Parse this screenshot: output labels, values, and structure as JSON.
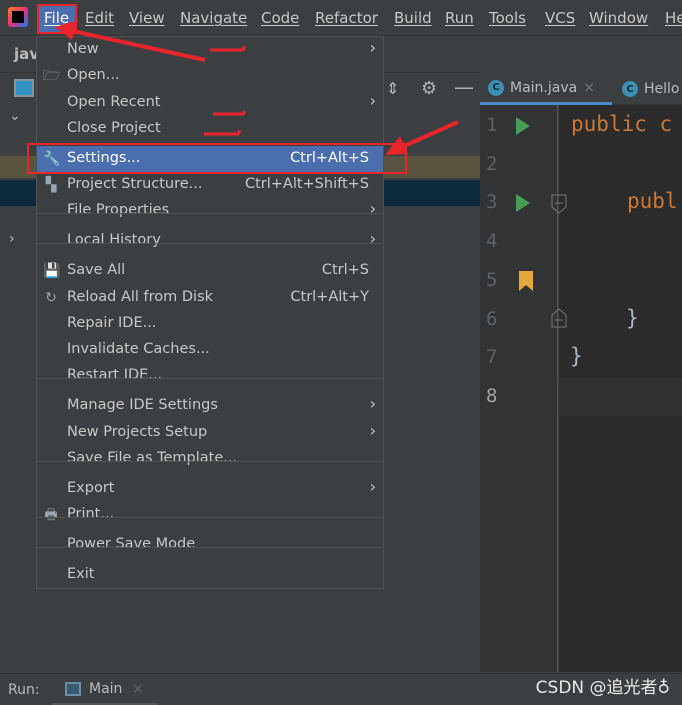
{
  "menubar": [
    "File",
    "Edit",
    "View",
    "Navigate",
    "Code",
    "Refactor",
    "Build",
    "Run",
    "Tools",
    "VCS",
    "Window",
    "He"
  ],
  "project_label": "jav",
  "editor": {
    "tabs": [
      "Main.java",
      "Hello"
    ],
    "line_numbers": [
      "1",
      "2",
      "3",
      "4",
      "5",
      "6",
      "7",
      "8"
    ],
    "code": [
      {
        "line": 1,
        "text": "public c"
      },
      {
        "line": 3,
        "text": "publ"
      },
      {
        "line": 6,
        "text": "}"
      },
      {
        "line": 7,
        "text": "}"
      }
    ]
  },
  "file_menu": {
    "items": [
      {
        "label": "New",
        "submenu": true
      },
      {
        "label": "Open...",
        "icon": "folder-icon"
      },
      {
        "label": "Open Recent",
        "submenu": true
      },
      {
        "label": "Close Project"
      },
      {
        "label": "Settings...",
        "shortcut": "Ctrl+Alt+S",
        "icon": "wrench-icon",
        "selected": true
      },
      {
        "label": "Project Structure...",
        "shortcut": "Ctrl+Alt+Shift+S",
        "icon": "project-structure-icon"
      },
      {
        "label": "File Properties",
        "submenu": true
      },
      {
        "label": "Local History",
        "submenu": true
      },
      {
        "label": "Save All",
        "shortcut": "Ctrl+S",
        "icon": "save-icon"
      },
      {
        "label": "Reload All from Disk",
        "shortcut": "Ctrl+Alt+Y",
        "icon": "reload-icon"
      },
      {
        "label": "Repair IDE..."
      },
      {
        "label": "Invalidate Caches..."
      },
      {
        "label": "Restart IDE..."
      },
      {
        "label": "Manage IDE Settings",
        "submenu": true
      },
      {
        "label": "New Projects Setup",
        "submenu": true
      },
      {
        "label": "Save File as Template..."
      },
      {
        "label": "Export",
        "submenu": true
      },
      {
        "label": "Print...",
        "icon": "print-icon"
      },
      {
        "label": "Power Save Mode"
      },
      {
        "label": "Exit"
      }
    ]
  },
  "bottom": {
    "run_label": "Run:",
    "run_tab": "Main"
  },
  "watermark": "CSDN @追光者♁",
  "colors": {
    "selection": "#4b6eaf",
    "annotation": "#e8252a",
    "keyword": "#cc7832",
    "run": "#499c54",
    "bookmark": "#e5a93b"
  }
}
